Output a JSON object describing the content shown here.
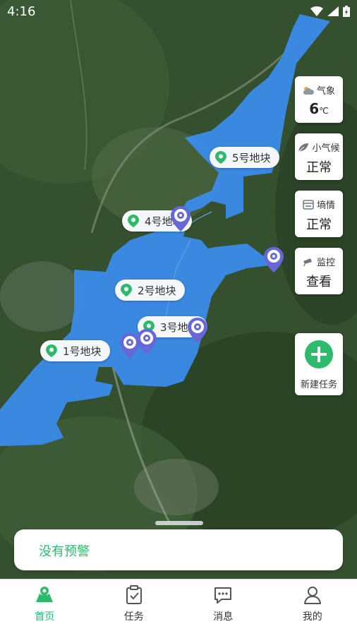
{
  "status_bar": {
    "time": "4:16"
  },
  "map": {
    "plots": [
      {
        "label": "1号地块"
      },
      {
        "label": "2号地块"
      },
      {
        "label": "3号地块"
      },
      {
        "label": "4号地块"
      },
      {
        "label": "5号地块"
      }
    ],
    "cameras": 5,
    "plot_color": "#3b8bea",
    "pin_color": "#2dbb6b",
    "camera_color": "#6668d8"
  },
  "side_panel": {
    "weather": {
      "title": "气象",
      "value": "6",
      "unit": "℃",
      "icon": "cloud-sun-icon"
    },
    "microclimate": {
      "title": "小气候",
      "value": "正常",
      "icon": "leaf-icon"
    },
    "soil": {
      "title": "墒情",
      "value": "正常",
      "icon": "soil-icon"
    },
    "monitor": {
      "title": "监控",
      "value": "查看",
      "icon": "camera-icon"
    },
    "new_task": {
      "label": "新建任务",
      "icon": "plus-icon"
    }
  },
  "alert": {
    "text": "没有预警"
  },
  "tabs": [
    {
      "label": "首页",
      "icon": "map-icon",
      "active": true
    },
    {
      "label": "任务",
      "icon": "clipboard-icon",
      "active": false
    },
    {
      "label": "消息",
      "icon": "message-icon",
      "active": false
    },
    {
      "label": "我的",
      "icon": "user-icon",
      "active": false
    }
  ],
  "accent_color": "#2dbb6b"
}
